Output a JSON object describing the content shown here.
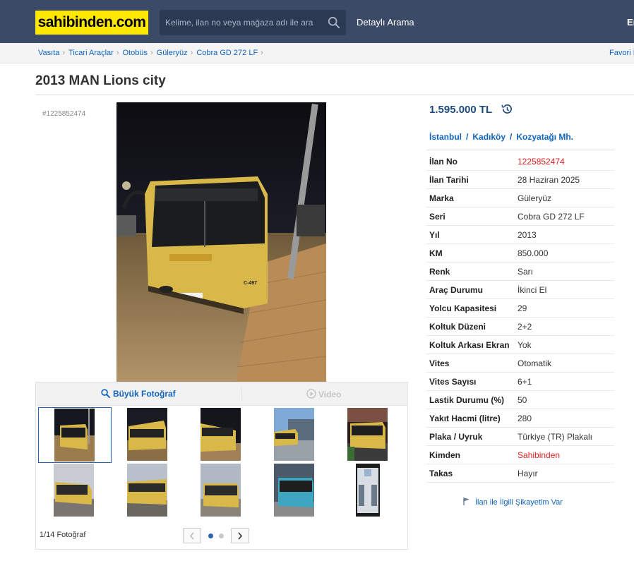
{
  "header": {
    "logo": "sahibinden.com",
    "search_placeholder": "Kelime, ilan no veya mağaza adı ile ara",
    "detailed_search": "Detaylı Arama",
    "right_link": "Er"
  },
  "breadcrumb": {
    "items": [
      "Vasıta",
      "Ticari Araçlar",
      "Otobüs",
      "Güleryüz",
      "Cobra GD 272 LF"
    ],
    "separator": "›",
    "right_link": "Favori İ"
  },
  "listing": {
    "title": "2013 MAN Lions city",
    "id_tag": "#1225852474",
    "price": "1.595.000 TL",
    "location": [
      "İstanbul",
      "Kadıköy",
      "Kozyatağı Mh."
    ],
    "location_separator": "/"
  },
  "gallery": {
    "big_photo_label": "Büyük Fotoğraf",
    "video_label": "Video",
    "counter": "1/14 Fotoğraf",
    "active_dot": 1,
    "dots": 2
  },
  "specs": [
    {
      "label": "İlan No",
      "value": "1225852474",
      "highlight": true
    },
    {
      "label": "İlan Tarihi",
      "value": "28 Haziran 2025"
    },
    {
      "label": "Marka",
      "value": "Güleryüz"
    },
    {
      "label": "Seri",
      "value": "Cobra GD 272 LF"
    },
    {
      "label": "Yıl",
      "value": "2013"
    },
    {
      "label": "KM",
      "value": "850.000"
    },
    {
      "label": "Renk",
      "value": "Sarı"
    },
    {
      "label": "Araç Durumu",
      "value": "İkinci El"
    },
    {
      "label": "Yolcu Kapasitesi",
      "value": "29"
    },
    {
      "label": "Koltuk Düzeni",
      "value": "2+2"
    },
    {
      "label": "Koltuk Arkası Ekran",
      "value": "Yok"
    },
    {
      "label": "Vites",
      "value": "Otomatik"
    },
    {
      "label": "Vites Sayısı",
      "value": "6+1"
    },
    {
      "label": "Lastik Durumu (%)",
      "value": "50"
    },
    {
      "label": "Yakıt Hacmi (litre)",
      "value": "280"
    },
    {
      "label": "Plaka / Uyruk",
      "value": "Türkiye (TR) Plakalı"
    },
    {
      "label": "Kimden",
      "value": "Sahibinden",
      "highlight": true
    },
    {
      "label": "Takas",
      "value": "Hayır"
    }
  ],
  "complaint_link": "İlan ile İlgili Şikayetim Var",
  "colors": {
    "header_bg": "#3b4a66",
    "logo_bg": "#ffe800",
    "link": "#1064bc",
    "price": "#1f4a7c",
    "highlight": "#e02020",
    "bus_yellow": "#e8c547"
  }
}
